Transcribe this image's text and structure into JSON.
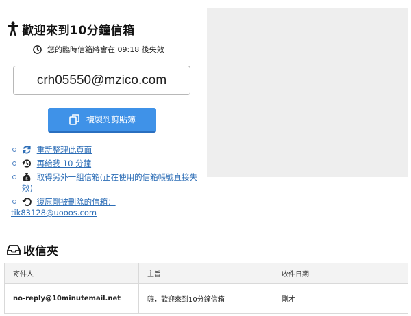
{
  "header": {
    "title": "歡迎來到10分鐘信箱",
    "title_icon": "person-icon"
  },
  "timer": {
    "text": "您的臨時信箱將會在 09:18 後失效",
    "icon": "clock-icon"
  },
  "email": {
    "address": "crh05550@mzico.com"
  },
  "copy_button": {
    "label": "複製到剪貼簿",
    "icon": "copy-icon",
    "color": "#3f92e8"
  },
  "actions": [
    {
      "label": "重新整理此頁面",
      "icon": "refresh-icon"
    },
    {
      "label": "再給我 10 分鐘",
      "icon": "history-icon"
    },
    {
      "label": "取得另外一組信箱(正在使用的信箱帳號直接失效)",
      "icon": "money-bag-icon"
    },
    {
      "label": "復原剛被刪除的信箱：",
      "icon": "undo-icon",
      "extra": "tik83128@uooos.com"
    }
  ],
  "inbox": {
    "title": "收信夾",
    "icon": "inbox-icon",
    "columns": [
      "寄件人",
      "主旨",
      "收件日期"
    ],
    "rows": [
      {
        "sender": "no-reply@10minutemail.net",
        "subject": "嗨，歡迎來到10分鐘信箱",
        "date": "剛才"
      }
    ]
  }
}
